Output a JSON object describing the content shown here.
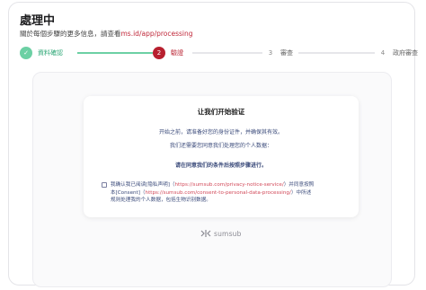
{
  "header": {
    "title": "處理中",
    "subtitle_prefix": "關於每個步驟的更多信息，請查看",
    "subtitle_link": "ms.id/app/processing"
  },
  "steps": [
    {
      "number": "✓",
      "label": "資料確認",
      "state": "done"
    },
    {
      "number": "2",
      "label": "驗證",
      "state": "active"
    },
    {
      "number": "3",
      "label": "審查",
      "state": "pending"
    },
    {
      "number": "4",
      "label": "政府審查",
      "state": "pending"
    }
  ],
  "card": {
    "title": "让我们开始验证",
    "line1": "开始之前，请准备好您的身份证件，并确保其有效。",
    "line2": "我们还需要您同意我们处理您的个人数据：",
    "bold": "请在同意我们的条件后按照步骤进行。",
    "consent_line1_a": "我确认我已阅读[隐私声明]（",
    "consent_line1_link": "https://sumsub.com/privacy-notice-service/",
    "consent_line1_b": "）并同意按照",
    "consent_line2_a": "本[Consent]（",
    "consent_line2_link": "https://sumsub.com/consent-to-personal-data-processing/",
    "consent_line2_b": "）中所述",
    "consent_line3": "规则处理我的个人数据，包括生物识别数据。"
  },
  "brand": {
    "name": "sumsub",
    "icon": "sumsub-logo-icon"
  },
  "colors": {
    "done": "#6cd0a4",
    "active": "#b8202f",
    "link": "#c0283a"
  }
}
